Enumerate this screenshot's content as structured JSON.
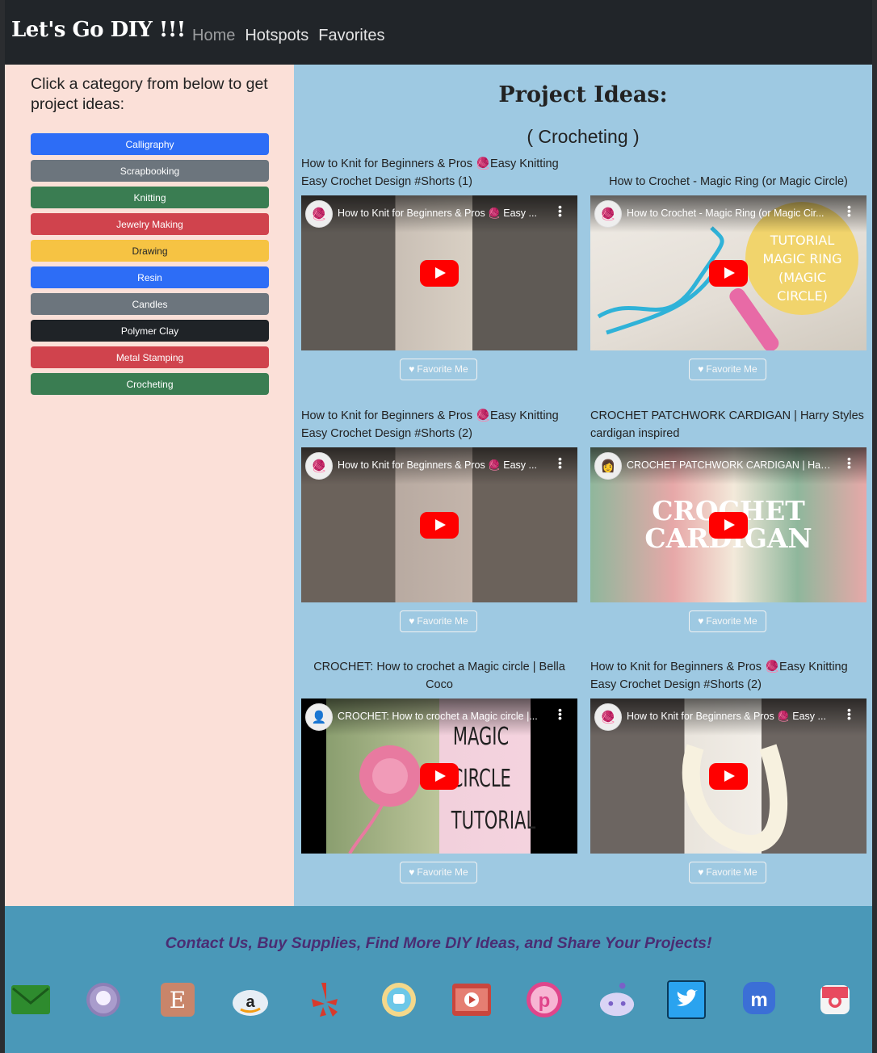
{
  "navbar": {
    "brand": "Let's Go DIY !!!",
    "links": [
      "Home",
      "Hotspots",
      "Favorites"
    ]
  },
  "sidebar": {
    "heading": "Click a category from below to get project ideas:",
    "categories": [
      "Calligraphy",
      "Scrapbooking",
      "Knitting",
      "Jewelry Making",
      "Drawing",
      "Resin",
      "Candles",
      "Polymer Clay",
      "Metal Stamping",
      "Crocheting"
    ]
  },
  "main": {
    "title": "Project Ideas:",
    "subtitle": "( Crocheting )",
    "favorite_label": "Favorite Me",
    "cards": [
      {
        "title": "How to Knit for Beginners & Pros 🧶Easy Knitting Easy Crochet Design #Shorts (1)",
        "video_title": "How to Knit for Beginners & Pros 🧶 Easy ..."
      },
      {
        "title": "How to Crochet - Magic Ring (or Magic Circle)",
        "video_title": "How to Crochet - Magic Ring (or Magic Cir...",
        "overlay": "TUTORIAL MAGIC RING (MAGIC CIRCLE)"
      },
      {
        "title": "How to Knit for Beginners & Pros 🧶Easy Knitting Easy Crochet Design #Shorts (2)",
        "video_title": "How to Knit for Beginners & Pros 🧶 Easy ..."
      },
      {
        "title": "CROCHET PATCHWORK CARDIGAN | Harry Styles cardigan inspired",
        "video_title": "CROCHET PATCHWORK CARDIGAN | Harr...",
        "overlay": "CROCHET CARDIGAN"
      },
      {
        "title": "CROCHET: How to crochet a Magic circle | Bella Coco",
        "video_title": "CROCHET: How to crochet a Magic circle |...",
        "overlay": "MAGIC CIRCLE TUTORIAL"
      },
      {
        "title": "How to Knit for Beginners & Pros 🧶Easy Knitting Easy Crochet Design #Shorts (2)",
        "video_title": "How to Knit for Beginners & Pros 🧶 Easy ..."
      }
    ]
  },
  "footer": {
    "text": "Contact Us, Buy Supplies, Find More DIY Ideas, and Share Your Projects!",
    "socials": [
      "mail-icon",
      "github-icon",
      "etsy-icon",
      "amazon-icon",
      "yelp-icon",
      "waze-icon",
      "youtube-icon",
      "pinterest-icon",
      "reddit-icon",
      "twitter-icon",
      "mastodon-icon",
      "instagram-icon"
    ]
  }
}
